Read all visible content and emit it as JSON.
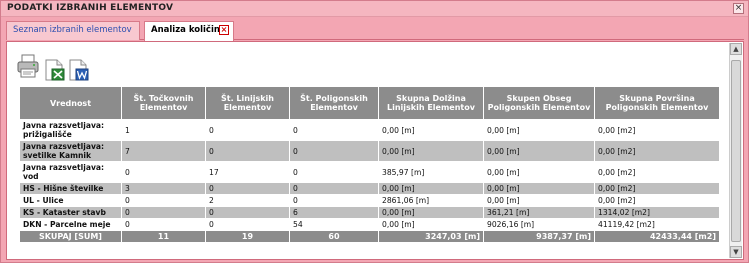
{
  "window": {
    "title": "PODATKI IZBRANIH ELEMENTOV",
    "close_glyph": "×"
  },
  "tabs": [
    {
      "label": "Seznam izbranih elementov"
    },
    {
      "label": "Analiza količin",
      "close_glyph": "×"
    }
  ],
  "toolbar": {
    "icons": [
      "printer-icon",
      "excel-export-icon",
      "word-export-icon"
    ]
  },
  "table": {
    "headers": [
      "Vrednost",
      "Št. Točkovnih Elementov",
      "Št. Linijskih Elementov",
      "Št. Poligonskih Elementov",
      "Skupna Dolžina Linijskih Elementov",
      "Skupen Obseg Poligonskih Elementov",
      "Skupna Površina Poligonskih Elementov"
    ],
    "rows": [
      [
        "Javna razsvetljava: prižigališče",
        "1",
        "0",
        "0",
        "0,00 [m]",
        "0,00 [m]",
        "0,00 [m2]"
      ],
      [
        "Javna razsvetljava: svetilke Kamnik",
        "7",
        "0",
        "0",
        "0,00 [m]",
        "0,00 [m]",
        "0,00 [m2]"
      ],
      [
        "Javna razsvetljava: vod",
        "0",
        "17",
        "0",
        "385,97 [m]",
        "0,00 [m]",
        "0,00 [m2]"
      ],
      [
        "HS - Hišne številke",
        "3",
        "0",
        "0",
        "0,00 [m]",
        "0,00 [m]",
        "0,00 [m2]"
      ],
      [
        "UL - Ulice",
        "0",
        "2",
        "0",
        "2861,06 [m]",
        "0,00 [m]",
        "0,00 [m2]"
      ],
      [
        "KS - Kataster stavb",
        "0",
        "0",
        "6",
        "0,00 [m]",
        "361,21 [m]",
        "1314,02 [m2]"
      ],
      [
        "DKN - Parcelne meje",
        "0",
        "0",
        "54",
        "0,00 [m]",
        "9026,16 [m]",
        "41119,42 [m2]"
      ]
    ],
    "total": [
      "SKUPAJ [SUM]",
      "11",
      "19",
      "60",
      "3247,03 [m]",
      "9387,37 [m]",
      "42433,44 [m2]"
    ]
  },
  "colors": {
    "window_bg": "#f3a7b3",
    "header_bg": "#8c8c8c",
    "alt_row_bg": "#bfbfbf",
    "tab_link": "#2d4fb0"
  }
}
